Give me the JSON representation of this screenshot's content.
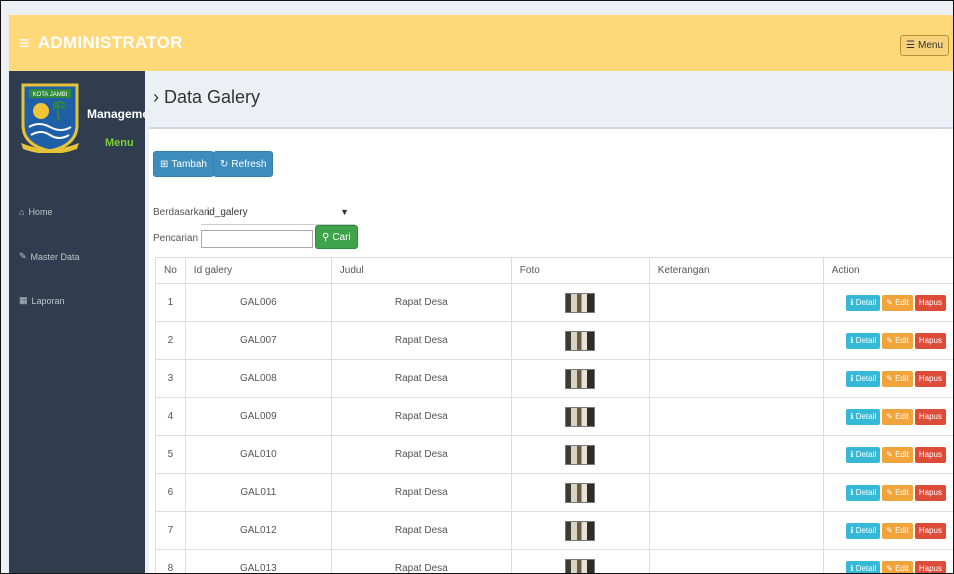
{
  "header": {
    "title": "ADMINISTRATOR",
    "menu_label": "Menu"
  },
  "sidebar": {
    "management": "Management",
    "menu": "Menu",
    "logo_text": "KOTA JAMBI",
    "items": [
      {
        "label": "Home",
        "icon": "home-icon"
      },
      {
        "label": "Master Data",
        "icon": "edit-icon"
      },
      {
        "label": "Laporan",
        "icon": "calendar-icon"
      }
    ]
  },
  "page": {
    "title": "Data Galery"
  },
  "toolbar": {
    "add_label": "Tambah",
    "refresh_label": "Refresh"
  },
  "filter": {
    "by_label": "Berdasarkan:",
    "by_value": "id_galery",
    "search_label": "Pencarian",
    "search_value": "",
    "search_button": "Cari"
  },
  "table": {
    "headers": [
      "No",
      "Id galery",
      "Judul",
      "Foto",
      "Keterangan",
      "Action"
    ],
    "rows": [
      {
        "no": "1",
        "id": "GAL006",
        "judul": "Rapat Desa",
        "ket": ""
      },
      {
        "no": "2",
        "id": "GAL007",
        "judul": "Rapat Desa",
        "ket": ""
      },
      {
        "no": "3",
        "id": "GAL008",
        "judul": "Rapat Desa",
        "ket": ""
      },
      {
        "no": "4",
        "id": "GAL009",
        "judul": "Rapat Desa",
        "ket": ""
      },
      {
        "no": "5",
        "id": "GAL010",
        "judul": "Rapat Desa",
        "ket": ""
      },
      {
        "no": "6",
        "id": "GAL011",
        "judul": "Rapat Desa",
        "ket": ""
      },
      {
        "no": "7",
        "id": "GAL012",
        "judul": "Rapat Desa",
        "ket": ""
      },
      {
        "no": "8",
        "id": "GAL013",
        "judul": "Rapat Desa",
        "ket": ""
      }
    ],
    "actions": {
      "detail": "Detail",
      "edit": "Edit",
      "hapus": "Hapus"
    }
  }
}
